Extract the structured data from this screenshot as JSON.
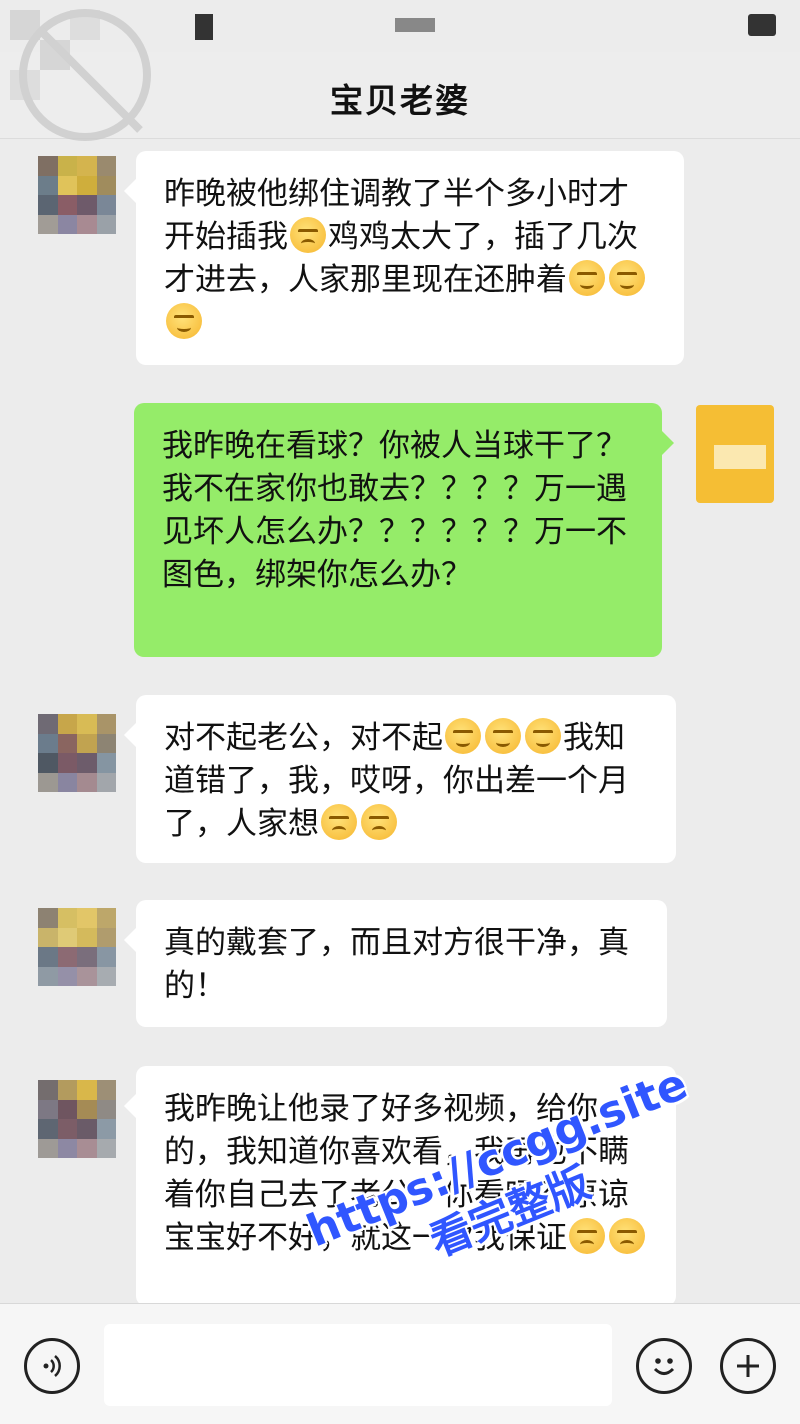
{
  "header": {
    "title": "宝贝老婆"
  },
  "messages": [
    {
      "side": "in",
      "parts": [
        "昨晚被他绑住调教了半个多小时才开始插我",
        "鸡鸡太大了，插了几次才进去，人家那里现在还肿着"
      ]
    },
    {
      "side": "out",
      "text": "我昨晚在看球？你被人当球干了？我不在家你也敢去？？？？万一遇见坏人怎么办？？？？？？万一不图色，绑架你怎么办？"
    },
    {
      "side": "in",
      "parts": [
        "对不起老公，对不起",
        "我知道错了，我，哎呀，你出差一个月了，人家想"
      ]
    },
    {
      "side": "in",
      "text": "真的戴套了，而且对方很干净，真的！"
    },
    {
      "side": "in",
      "text": "我昨晚让他录了好多视频，给你的，我知道你喜欢看，我再也不瞒着你自己去了老公，你看吗？原谅宝宝好不好，就这一次我保证"
    }
  ],
  "icons": {
    "voice": "voice-icon",
    "emoji": "emoji-icon",
    "plus": "plus-icon"
  },
  "input": {
    "value": ""
  },
  "watermark": {
    "url": "https://ccgg.site",
    "text": "看完整版"
  }
}
